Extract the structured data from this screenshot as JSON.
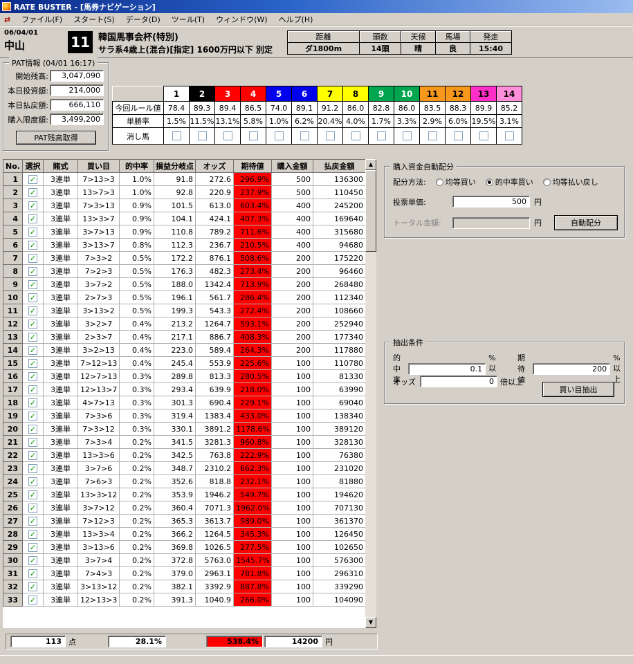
{
  "window": {
    "title": "RATE BUSTER - [馬券ナビゲーション]"
  },
  "icons": {
    "app_icon": "✦",
    "mdi_icon": "⇄",
    "up_arrow": "▲",
    "down_arrow": "▼",
    "check": "✓"
  },
  "menu": {
    "items": [
      "ファイル(F)",
      "スタート(S)",
      "データ(D)",
      "ツール(T)",
      "ウィンドウ(W)",
      "ヘルプ(H)"
    ]
  },
  "race": {
    "date": "06/04/01",
    "track": "中山",
    "number": "11",
    "name": "韓国馬事会杯(特別)",
    "condition": "サラ系4歳上(混合)[指定] 1600万円以下 別定",
    "info": [
      {
        "label": "距離",
        "value": "ダ1800m"
      },
      {
        "label": "頭数",
        "value": "14頭"
      },
      {
        "label": "天候",
        "value": "晴"
      },
      {
        "label": "馬場",
        "value": "良"
      },
      {
        "label": "発走",
        "value": "15:40"
      }
    ]
  },
  "pat": {
    "title": "PAT情報 (04/01 16:17)",
    "fields": [
      {
        "label": "開始残高:",
        "value": "3,047,090"
      },
      {
        "label": "本日投資額:",
        "value": "214,000"
      },
      {
        "label": "本日払戻額:",
        "value": "666,110"
      },
      {
        "label": "購入限度額:",
        "value": "3,499,200"
      }
    ],
    "button_label": "PAT残高取得"
  },
  "horse_table": {
    "rule_row_label": "今回ルール値",
    "win_row_label": "単勝率",
    "scratch_row_label": "消し馬",
    "horses": [
      {
        "num": "1",
        "bg": "#ffffff",
        "fg": "#000000",
        "rule": "78.4",
        "win": "1.5%"
      },
      {
        "num": "2",
        "bg": "#000000",
        "fg": "#ffffff",
        "rule": "89.3",
        "win": "11.5%"
      },
      {
        "num": "3",
        "bg": "#ff0000",
        "fg": "#ffffff",
        "rule": "89.4",
        "win": "13.1%"
      },
      {
        "num": "4",
        "bg": "#ff0000",
        "fg": "#ffffff",
        "rule": "86.5",
        "win": "5.8%"
      },
      {
        "num": "5",
        "bg": "#0000ee",
        "fg": "#ffffff",
        "rule": "74.0",
        "win": "1.0%"
      },
      {
        "num": "6",
        "bg": "#0000ee",
        "fg": "#ffffff",
        "rule": "89.1",
        "win": "6.2%"
      },
      {
        "num": "7",
        "bg": "#ffff00",
        "fg": "#000000",
        "rule": "91.2",
        "win": "20.4%"
      },
      {
        "num": "8",
        "bg": "#ffff00",
        "fg": "#000000",
        "rule": "86.0",
        "win": "4.0%"
      },
      {
        "num": "9",
        "bg": "#00a550",
        "fg": "#ffffff",
        "rule": "82.8",
        "win": "1.7%"
      },
      {
        "num": "10",
        "bg": "#00a550",
        "fg": "#ffffff",
        "rule": "86.0",
        "win": "3.3%"
      },
      {
        "num": "11",
        "bg": "#f7981d",
        "fg": "#000000",
        "rule": "83.5",
        "win": "2.9%"
      },
      {
        "num": "12",
        "bg": "#f7981d",
        "fg": "#000000",
        "rule": "88.3",
        "win": "6.0%"
      },
      {
        "num": "13",
        "bg": "#ff2ec9",
        "fg": "#000000",
        "rule": "89.9",
        "win": "19.5%"
      },
      {
        "num": "14",
        "bg": "#ff8fd8",
        "fg": "#000000",
        "rule": "85.2",
        "win": "3.1%"
      }
    ]
  },
  "bet_table": {
    "headers": [
      "No.",
      "選択",
      "賭式",
      "買い目",
      "的中率",
      "損益分岐点",
      "オッズ",
      "期待値",
      "購入金額",
      "払戻金額"
    ],
    "expected_bg": "#ff0000",
    "rows": [
      {
        "no": "1",
        "checked": true,
        "type": "3連単",
        "target": "7>13>3",
        "hit": "1.0%",
        "breakeven": "91.8",
        "odds": "272.6",
        "expected": "296.9%",
        "amount": "500",
        "payout": "136300"
      },
      {
        "no": "2",
        "checked": true,
        "type": "3連単",
        "target": "13>7>3",
        "hit": "1.0%",
        "breakeven": "92.8",
        "odds": "220.9",
        "expected": "237.9%",
        "amount": "500",
        "payout": "110450"
      },
      {
        "no": "3",
        "checked": true,
        "type": "3連単",
        "target": "7>3>13",
        "hit": "0.9%",
        "breakeven": "101.5",
        "odds": "613.0",
        "expected": "603.4%",
        "amount": "400",
        "payout": "245200"
      },
      {
        "no": "4",
        "checked": true,
        "type": "3連単",
        "target": "13>3>7",
        "hit": "0.9%",
        "breakeven": "104.1",
        "odds": "424.1",
        "expected": "407.3%",
        "amount": "400",
        "payout": "169640"
      },
      {
        "no": "5",
        "checked": true,
        "type": "3連単",
        "target": "3>7>13",
        "hit": "0.9%",
        "breakeven": "110.8",
        "odds": "789.2",
        "expected": "711.6%",
        "amount": "400",
        "payout": "315680"
      },
      {
        "no": "6",
        "checked": true,
        "type": "3連単",
        "target": "3>13>7",
        "hit": "0.8%",
        "breakeven": "112.3",
        "odds": "236.7",
        "expected": "210.5%",
        "amount": "400",
        "payout": "94680"
      },
      {
        "no": "7",
        "checked": true,
        "type": "3連単",
        "target": "7>3>2",
        "hit": "0.5%",
        "breakeven": "172.2",
        "odds": "876.1",
        "expected": "508.6%",
        "amount": "200",
        "payout": "175220"
      },
      {
        "no": "8",
        "checked": true,
        "type": "3連単",
        "target": "7>2>3",
        "hit": "0.5%",
        "breakeven": "176.3",
        "odds": "482.3",
        "expected": "273.4%",
        "amount": "200",
        "payout": "96460"
      },
      {
        "no": "9",
        "checked": true,
        "type": "3連単",
        "target": "3>7>2",
        "hit": "0.5%",
        "breakeven": "188.0",
        "odds": "1342.4",
        "expected": "713.9%",
        "amount": "200",
        "payout": "268480"
      },
      {
        "no": "10",
        "checked": true,
        "type": "3連単",
        "target": "2>7>3",
        "hit": "0.5%",
        "breakeven": "196.1",
        "odds": "561.7",
        "expected": "286.4%",
        "amount": "200",
        "payout": "112340"
      },
      {
        "no": "11",
        "checked": true,
        "type": "3連単",
        "target": "3>13>2",
        "hit": "0.5%",
        "breakeven": "199.3",
        "odds": "543.3",
        "expected": "272.4%",
        "amount": "200",
        "payout": "108660"
      },
      {
        "no": "12",
        "checked": true,
        "type": "3連単",
        "target": "3>2>7",
        "hit": "0.4%",
        "breakeven": "213.2",
        "odds": "1264.7",
        "expected": "593.1%",
        "amount": "200",
        "payout": "252940"
      },
      {
        "no": "13",
        "checked": true,
        "type": "3連単",
        "target": "2>3>7",
        "hit": "0.4%",
        "breakeven": "217.1",
        "odds": "886.7",
        "expected": "408.3%",
        "amount": "200",
        "payout": "177340"
      },
      {
        "no": "14",
        "checked": true,
        "type": "3連単",
        "target": "3>2>13",
        "hit": "0.4%",
        "breakeven": "223.0",
        "odds": "589.4",
        "expected": "264.3%",
        "amount": "200",
        "payout": "117880"
      },
      {
        "no": "15",
        "checked": true,
        "type": "3連単",
        "target": "7>12>13",
        "hit": "0.4%",
        "breakeven": "245.4",
        "odds": "553.9",
        "expected": "225.6%",
        "amount": "100",
        "payout": "110780"
      },
      {
        "no": "16",
        "checked": true,
        "type": "3連単",
        "target": "12>7>13",
        "hit": "0.3%",
        "breakeven": "289.8",
        "odds": "813.3",
        "expected": "280.5%",
        "amount": "100",
        "payout": "81330"
      },
      {
        "no": "17",
        "checked": true,
        "type": "3連単",
        "target": "12>13>7",
        "hit": "0.3%",
        "breakeven": "293.4",
        "odds": "639.9",
        "expected": "218.0%",
        "amount": "100",
        "payout": "63990"
      },
      {
        "no": "18",
        "checked": true,
        "type": "3連単",
        "target": "4>7>13",
        "hit": "0.3%",
        "breakeven": "301.3",
        "odds": "690.4",
        "expected": "229.1%",
        "amount": "100",
        "payout": "69040"
      },
      {
        "no": "19",
        "checked": true,
        "type": "3連単",
        "target": "7>3>6",
        "hit": "0.3%",
        "breakeven": "319.4",
        "odds": "1383.4",
        "expected": "433.0%",
        "amount": "100",
        "payout": "138340"
      },
      {
        "no": "20",
        "checked": true,
        "type": "3連単",
        "target": "7>3>12",
        "hit": "0.3%",
        "breakeven": "330.1",
        "odds": "3891.2",
        "expected": "1178.6%",
        "amount": "100",
        "payout": "389120"
      },
      {
        "no": "21",
        "checked": true,
        "type": "3連単",
        "target": "7>3>4",
        "hit": "0.2%",
        "breakeven": "341.5",
        "odds": "3281.3",
        "expected": "960.8%",
        "amount": "100",
        "payout": "328130"
      },
      {
        "no": "22",
        "checked": true,
        "type": "3連単",
        "target": "13>3>6",
        "hit": "0.2%",
        "breakeven": "342.5",
        "odds": "763.8",
        "expected": "222.9%",
        "amount": "100",
        "payout": "76380"
      },
      {
        "no": "23",
        "checked": true,
        "type": "3連単",
        "target": "3>7>6",
        "hit": "0.2%",
        "breakeven": "348.7",
        "odds": "2310.2",
        "expected": "662.3%",
        "amount": "100",
        "payout": "231020"
      },
      {
        "no": "24",
        "checked": true,
        "type": "3連単",
        "target": "7>6>3",
        "hit": "0.2%",
        "breakeven": "352.6",
        "odds": "818.8",
        "expected": "232.1%",
        "amount": "100",
        "payout": "81880"
      },
      {
        "no": "25",
        "checked": true,
        "type": "3連単",
        "target": "13>3>12",
        "hit": "0.2%",
        "breakeven": "353.9",
        "odds": "1946.2",
        "expected": "549.7%",
        "amount": "100",
        "payout": "194620"
      },
      {
        "no": "26",
        "checked": true,
        "type": "3連単",
        "target": "3>7>12",
        "hit": "0.2%",
        "breakeven": "360.4",
        "odds": "7071.3",
        "expected": "1962.0%",
        "amount": "100",
        "payout": "707130"
      },
      {
        "no": "27",
        "checked": true,
        "type": "3連単",
        "target": "7>12>3",
        "hit": "0.2%",
        "breakeven": "365.3",
        "odds": "3613.7",
        "expected": "989.0%",
        "amount": "100",
        "payout": "361370"
      },
      {
        "no": "28",
        "checked": true,
        "type": "3連単",
        "target": "13>3>4",
        "hit": "0.2%",
        "breakeven": "366.2",
        "odds": "1264.5",
        "expected": "345.3%",
        "amount": "100",
        "payout": "126450"
      },
      {
        "no": "29",
        "checked": true,
        "type": "3連単",
        "target": "3>13>6",
        "hit": "0.2%",
        "breakeven": "369.8",
        "odds": "1026.5",
        "expected": "277.5%",
        "amount": "100",
        "payout": "102650"
      },
      {
        "no": "30",
        "checked": true,
        "type": "3連単",
        "target": "3>7>4",
        "hit": "0.2%",
        "breakeven": "372.8",
        "odds": "5763.0",
        "expected": "1545.7%",
        "amount": "100",
        "payout": "576300"
      },
      {
        "no": "31",
        "checked": true,
        "type": "3連単",
        "target": "7>4>3",
        "hit": "0.2%",
        "breakeven": "379.0",
        "odds": "2963.1",
        "expected": "781.8%",
        "amount": "100",
        "payout": "296310"
      },
      {
        "no": "32",
        "checked": true,
        "type": "3連単",
        "target": "3>13>12",
        "hit": "0.2%",
        "breakeven": "382.1",
        "odds": "3392.9",
        "expected": "887.8%",
        "amount": "100",
        "payout": "339290"
      },
      {
        "no": "33",
        "checked": true,
        "type": "3連単",
        "target": "12>13>3",
        "hit": "0.2%",
        "breakeven": "391.3",
        "odds": "1040.9",
        "expected": "266.0%",
        "amount": "100",
        "payout": "104090"
      }
    ]
  },
  "allocation": {
    "title": "購入資金自動配分",
    "method_label": "配分方法:",
    "methods": [
      {
        "label": "均等買い",
        "selected": false
      },
      {
        "label": "的中率買い",
        "selected": true
      },
      {
        "label": "均等払い戻し",
        "selected": false
      }
    ],
    "unit_label": "投票単価:",
    "unit_value": "500",
    "unit_unit": "円",
    "total_label": "トータル金額:",
    "total_unit": "円",
    "button_label": "自動配分"
  },
  "extract": {
    "title": "抽出条件",
    "hit_label": "的中率",
    "hit_value": "0.1",
    "hit_unit": "%以上",
    "expected_label": "期待値",
    "expected_value": "200",
    "expected_unit": "%以上",
    "odds_label": "オッズ",
    "odds_value": "0",
    "odds_unit": "倍以上",
    "button_label": "買い目抽出"
  },
  "status": {
    "points": "113",
    "points_unit": "点",
    "hit_rate": "28.1%",
    "expected": "538.4%",
    "expected_bg": "#ff0000",
    "amount": "14200",
    "amount_unit": "円"
  }
}
